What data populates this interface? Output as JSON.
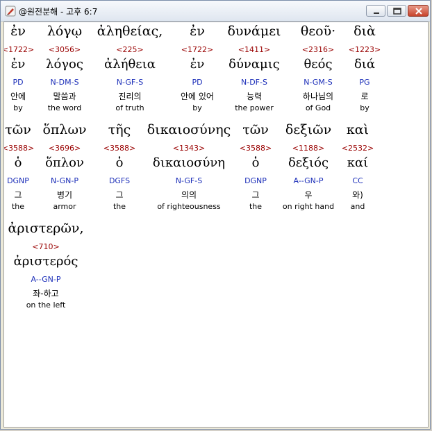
{
  "window": {
    "title": "@원전분해 - 고후 6:7",
    "app_icon": "pen-icon",
    "controls": [
      "minimize-icon",
      "maximize-icon",
      "close-icon"
    ]
  },
  "rows": [
    {
      "words": [
        {
          "greek": "ἐν",
          "strong": "<1722>",
          "lemma": "ἐν",
          "morph": "PD",
          "korean": "안에",
          "english": "by"
        },
        {
          "greek": "λόγῳ",
          "strong": "<3056>",
          "lemma": "λόγος",
          "morph": "N-DM-S",
          "korean": "말씀과",
          "english": "the word"
        },
        {
          "greek": "ἀληθείας,",
          "strong": "<225>",
          "lemma": "ἀλήθεια",
          "morph": "N-GF-S",
          "korean": "진리의",
          "english": "of truth"
        },
        {
          "greek": "ἐν",
          "strong": "<1722>",
          "lemma": "ἐν",
          "morph": "PD",
          "korean": "안에 있어",
          "english": "by"
        },
        {
          "greek": "δυνάμει",
          "strong": "<1411>",
          "lemma": "δύναμις",
          "morph": "N-DF-S",
          "korean": "능력",
          "english": "the power"
        },
        {
          "greek": "θεοῦ·",
          "strong": "<2316>",
          "lemma": "θεός",
          "morph": "N-GM-S",
          "korean": "하나님의",
          "english": "of God"
        },
        {
          "greek": "διὰ",
          "strong": "<1223>",
          "lemma": "διά",
          "morph": "PG",
          "korean": "로",
          "english": "by"
        }
      ]
    },
    {
      "words": [
        {
          "greek": "τῶν",
          "strong": "<3588>",
          "lemma": "ὁ",
          "morph": "DGNP",
          "korean": "그",
          "english": "the"
        },
        {
          "greek": "ὅπλων",
          "strong": "<3696>",
          "lemma": "ὅπλον",
          "morph": "N-GN-P",
          "korean": "병기",
          "english": "armor"
        },
        {
          "greek": "τῆς",
          "strong": "<3588>",
          "lemma": "ὁ",
          "morph": "DGFS",
          "korean": "그",
          "english": "the"
        },
        {
          "greek": "δικαιοσύνης",
          "strong": "<1343>",
          "lemma": "δικαιοσύνη",
          "morph": "N-GF-S",
          "korean": "의의",
          "english": "of righteousness"
        },
        {
          "greek": "τῶν",
          "strong": "<3588>",
          "lemma": "ὁ",
          "morph": "DGNP",
          "korean": "그",
          "english": "the"
        },
        {
          "greek": "δεξιῶν",
          "strong": "<1188>",
          "lemma": "δεξιός",
          "morph": "A--GN-P",
          "korean": "우",
          "english": "on right hand"
        },
        {
          "greek": "καὶ",
          "strong": "<2532>",
          "lemma": "καί",
          "morph": "CC",
          "korean": "와)",
          "english": "and"
        }
      ]
    },
    {
      "words": [
        {
          "greek": "ἀριστερῶν,",
          "strong": "<710>",
          "lemma": "ἀριστερός",
          "morph": "A--GN-P",
          "korean": "좌-하고",
          "english": "on the left"
        }
      ]
    }
  ]
}
